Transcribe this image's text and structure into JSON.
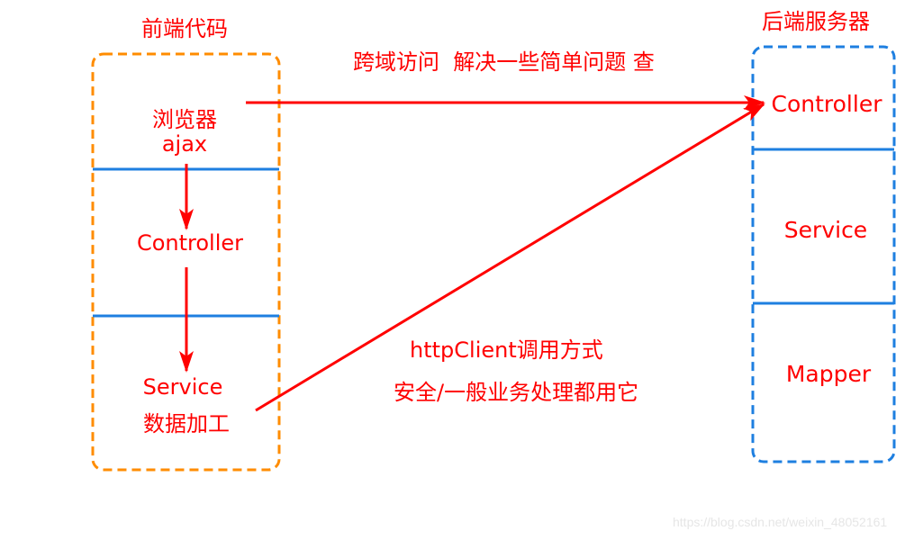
{
  "frontend": {
    "title": "前端代码",
    "sections": [
      {
        "lines": [
          "浏览器",
          "ajax"
        ]
      },
      {
        "lines": [
          "Controller"
        ]
      },
      {
        "lines": [
          "Service",
          "数据加工"
        ]
      }
    ]
  },
  "backend": {
    "title": "后端服务器",
    "sections": [
      {
        "lines": [
          "Controller"
        ]
      },
      {
        "lines": [
          "Service"
        ]
      },
      {
        "lines": [
          "Mapper"
        ]
      }
    ]
  },
  "annotations": {
    "cross_domain": "跨域访问  解决一些简单问题 查",
    "httpclient_line1": "httpClient调用方式",
    "httpclient_line2": "安全/一般业务处理都用它"
  },
  "colors": {
    "text": "#ff0000",
    "frontend_border": "#ff8c00",
    "backend_border": "#1e7fe0",
    "divider": "#1e7fe0",
    "arrow": "#ff0000"
  },
  "watermark": "https://blog.csdn.net/weixin_48052161"
}
